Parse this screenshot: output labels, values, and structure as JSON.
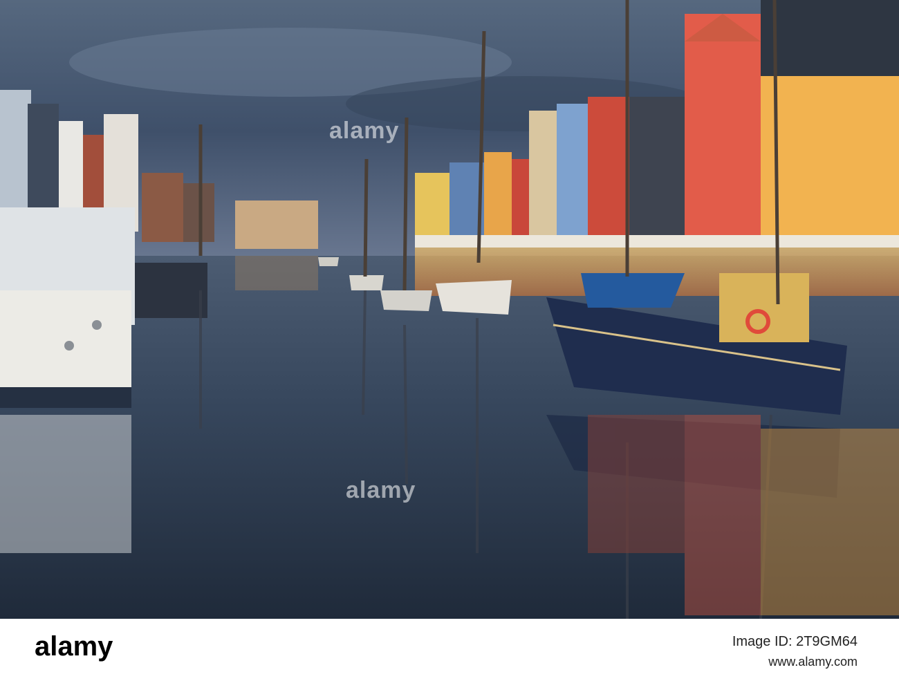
{
  "photo": {
    "scene": "Nyhavn canal at dusk with moored sailboats and colorful houses reflected in the water",
    "sky_color": "#4e6178",
    "water_color": "#34465a"
  },
  "watermark": {
    "text": "alamy"
  },
  "footer": {
    "logo": "alamy",
    "image_id": "Image ID: 2T9GM64",
    "site": "www.alamy.com"
  }
}
